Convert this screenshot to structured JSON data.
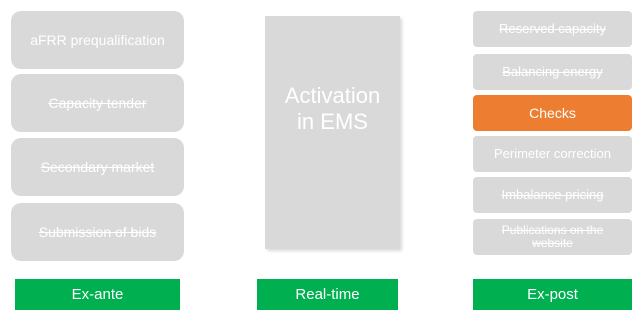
{
  "colors": {
    "box_gray": "#d9d9d9",
    "text_white": "#ffffff",
    "label_green": "#00b050",
    "highlight_orange": "#ed7d31"
  },
  "left_column": {
    "items": [
      {
        "label": "aFRR prequalification",
        "struck": false
      },
      {
        "label": "Capacity tender",
        "struck": true
      },
      {
        "label": "Secondary market",
        "struck": true
      },
      {
        "label": "Submission of bids",
        "struck": true
      }
    ],
    "footer_label": "Ex-ante"
  },
  "center_column": {
    "main_label": "Activation\nin EMS",
    "footer_label": "Real-time"
  },
  "right_column": {
    "items": [
      {
        "label": "Reserved capacity",
        "struck": true
      },
      {
        "label": "Balancing energy",
        "struck": true
      },
      {
        "label": "Checks",
        "struck": false,
        "highlight": true
      },
      {
        "label": "Perimeter correction",
        "struck": false
      },
      {
        "label": "Imbalance pricing",
        "struck": true
      },
      {
        "label": "Publications on the website",
        "struck": true
      }
    ],
    "footer_label": "Ex-post"
  }
}
